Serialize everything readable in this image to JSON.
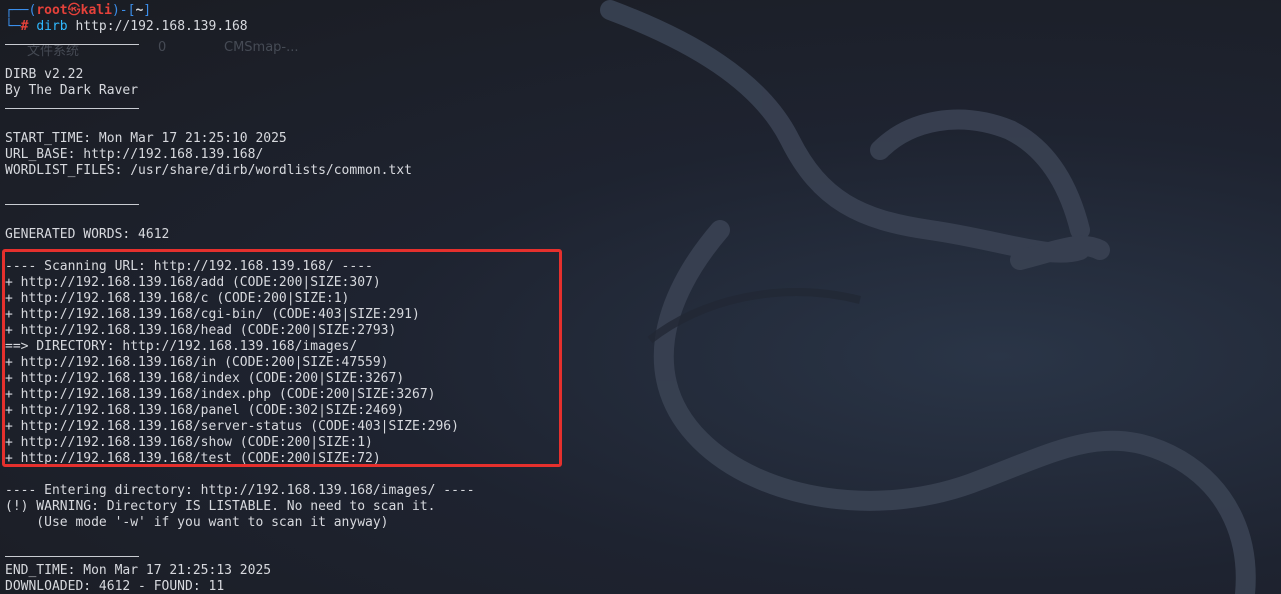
{
  "ghost_labels": {
    "filesystem": "文件系统",
    "zero": "0",
    "cmsmap": "CMSmap-..."
  },
  "prompt": {
    "frame_top_left": "┌──(",
    "user": "root",
    "skull": "㉿",
    "host": "kali",
    "frame_mid": ")-[",
    "path": "~",
    "frame_end": "]",
    "frame_bottom": "└─",
    "hash": "#",
    "command": "dirb",
    "argument": " http://192.168.139.168"
  },
  "header": {
    "version": "DIRB v2.22",
    "author": "By The Dark Raver"
  },
  "info": {
    "start_time": "START_TIME: Mon Mar 17 21:25:10 2025",
    "url_base": "URL_BASE: http://192.168.139.168/",
    "wordlist": "WORDLIST_FILES: /usr/share/dirb/wordlists/common.txt"
  },
  "generated": "GENERATED WORDS: 4612",
  "scan": {
    "heading": "---- Scanning URL: http://192.168.139.168/ ----",
    "results": [
      "+ http://192.168.139.168/add (CODE:200|SIZE:307)",
      "+ http://192.168.139.168/c (CODE:200|SIZE:1)",
      "+ http://192.168.139.168/cgi-bin/ (CODE:403|SIZE:291)",
      "+ http://192.168.139.168/head (CODE:200|SIZE:2793)",
      "==> DIRECTORY: http://192.168.139.168/images/",
      "+ http://192.168.139.168/in (CODE:200|SIZE:47559)",
      "+ http://192.168.139.168/index (CODE:200|SIZE:3267)",
      "+ http://192.168.139.168/index.php (CODE:200|SIZE:3267)",
      "+ http://192.168.139.168/panel (CODE:302|SIZE:2469)",
      "+ http://192.168.139.168/server-status (CODE:403|SIZE:296)",
      "+ http://192.168.139.168/show (CODE:200|SIZE:1)",
      "+ http://192.168.139.168/test (CODE:200|SIZE:72)"
    ]
  },
  "entering": {
    "line": "---- Entering directory: http://192.168.139.168/images/ ----",
    "warning": "(!) WARNING: Directory IS LISTABLE. No need to scan it.",
    "hint": "    (Use mode '-w' if you want to scan it anyway)"
  },
  "footer": {
    "end_time": "END_TIME: Mon Mar 17 21:25:13 2025",
    "downloaded": "DOWNLOADED: 4612 - FOUND: 11"
  },
  "colors": {
    "highlight_box": "#e5302d",
    "prompt_blue": "#3b8eea",
    "prompt_red": "#e5413a",
    "command_cyan": "#2fb9ff"
  }
}
